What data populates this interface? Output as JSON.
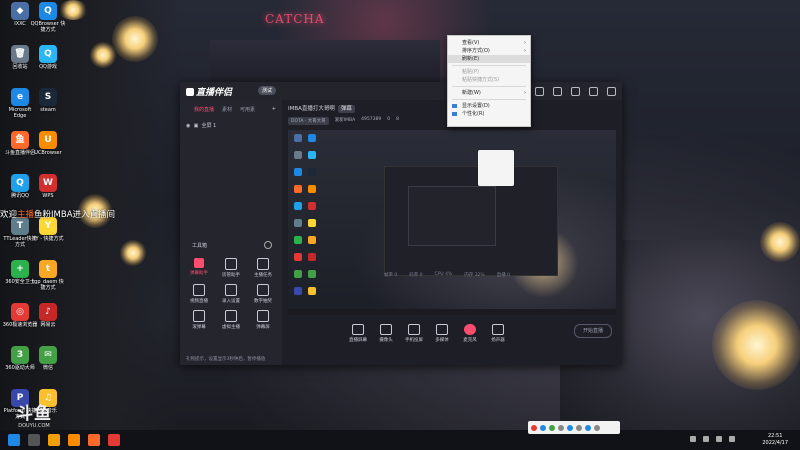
{
  "desktop": {
    "icons_col1": [
      {
        "label": "IXXC",
        "color": "#4a6fa5",
        "glyph": "◆"
      },
      {
        "label": "回收站",
        "color": "#6a7a8a",
        "glyph": "🗑"
      },
      {
        "label": "Microsoft Edge",
        "color": "#1e88e5",
        "glyph": "e"
      },
      {
        "label": "斗鱼直播伴侣",
        "color": "#ff6a2b",
        "glyph": "鱼"
      },
      {
        "label": "腾讯QQ",
        "color": "#1fa0e8",
        "glyph": "Q"
      },
      {
        "label": "TTLeader快捷方式",
        "color": "#607d8b",
        "glyph": "T"
      },
      {
        "label": "360安全卫士",
        "color": "#2bb24c",
        "glyph": "+"
      },
      {
        "label": "360极速浏览器",
        "color": "#e53935",
        "glyph": "◎"
      },
      {
        "label": "360驱动大师",
        "color": "#43a047",
        "glyph": "3"
      },
      {
        "label": "Platform 快捷方式",
        "color": "#3949ab",
        "glyph": "P"
      }
    ],
    "icons_col2": [
      {
        "label": "QQBrowser 快捷方式",
        "color": "#1e88e5",
        "glyph": "Q"
      },
      {
        "label": "QQ游戏",
        "color": "#29b6f6",
        "glyph": "Q"
      },
      {
        "label": "steam",
        "color": "#1b2838",
        "glyph": "S"
      },
      {
        "label": "UCBrowser",
        "color": "#fb8c00",
        "glyph": "U"
      },
      {
        "label": "WPS",
        "color": "#d32f2f",
        "glyph": "W"
      },
      {
        "label": "YY - 快捷方式",
        "color": "#fdd835",
        "glyph": "Y"
      },
      {
        "label": "tgp_daem 快捷方式",
        "color": "#f9a825",
        "glyph": "t"
      },
      {
        "label": "网易云",
        "color": "#c62828",
        "glyph": "♪"
      },
      {
        "label": "微信",
        "color": "#43a047",
        "glyph": "✉"
      },
      {
        "label": "QQ音乐",
        "color": "#fbc02d",
        "glyph": "♫"
      }
    ]
  },
  "danmaku": {
    "nick": "主播",
    "prefix": "欢迎",
    "text": "鱼粉IMBA进入直播间"
  },
  "city_sign": "CATCHA",
  "app": {
    "logo": "直播伴侣",
    "version": "测试",
    "left_tabs": [
      "我的直播",
      "素材",
      "可用素",
      "+"
    ],
    "scene": "全屏 1",
    "tools_header": "工具箱",
    "tools": [
      {
        "label": "弹幕助手",
        "hot": true
      },
      {
        "label": "房管助手",
        "hot": false
      },
      {
        "label": "主播任务",
        "hot": false
      },
      {
        "label": "视频直播",
        "hot": false
      },
      {
        "label": "录入设置",
        "hot": false
      },
      {
        "label": "数字抽奖",
        "hot": false
      },
      {
        "label": "滚弹幕",
        "hot": false
      },
      {
        "label": "虚拟主播",
        "hot": false
      },
      {
        "label": "弹幕屏",
        "hot": false
      }
    ],
    "left_footer": "礼物提示，设置显示3秒钟后，暂停播放",
    "room_title": "IMBA直播打大哥啊",
    "room_badge": "弹幕",
    "room_meta": [
      "DOTA · 大哥大哥",
      "爱新IMBA",
      "4957389",
      "0",
      "8"
    ],
    "controls": [
      "直播屏幕",
      "摄像头",
      "手机投屏",
      "多媒体",
      "麦克风",
      "扬声器"
    ],
    "start_button": "开始直播",
    "status": [
      "帧率 0",
      "码率 0",
      "CPU 4%",
      "内存 32%",
      "直播 0"
    ]
  },
  "context_menu": {
    "items": [
      {
        "label": "查看(V)",
        "arrow": true,
        "disabled": false,
        "highlight": false
      },
      {
        "label": "排序方式(O)",
        "arrow": true,
        "disabled": false,
        "highlight": false
      },
      {
        "label": "刷新(E)",
        "arrow": false,
        "disabled": false,
        "highlight": true
      },
      {
        "sep": true
      },
      {
        "label": "粘贴(P)",
        "arrow": false,
        "disabled": true,
        "highlight": false
      },
      {
        "label": "粘贴快捷方式(S)",
        "arrow": false,
        "disabled": true,
        "highlight": false
      },
      {
        "sep": true
      },
      {
        "label": "新建(W)",
        "arrow": true,
        "disabled": false,
        "highlight": false
      },
      {
        "sep": true
      },
      {
        "label": "显示设置(D)",
        "arrow": false,
        "disabled": false,
        "highlight": false,
        "icon": true
      },
      {
        "label": "个性化(R)",
        "arrow": false,
        "disabled": false,
        "highlight": false,
        "icon": true
      }
    ]
  },
  "watermark": {
    "logo": "斗鱼",
    "url": "DOUYU.COM"
  },
  "clock": {
    "time": "22:51",
    "date": "2022/4/17"
  }
}
